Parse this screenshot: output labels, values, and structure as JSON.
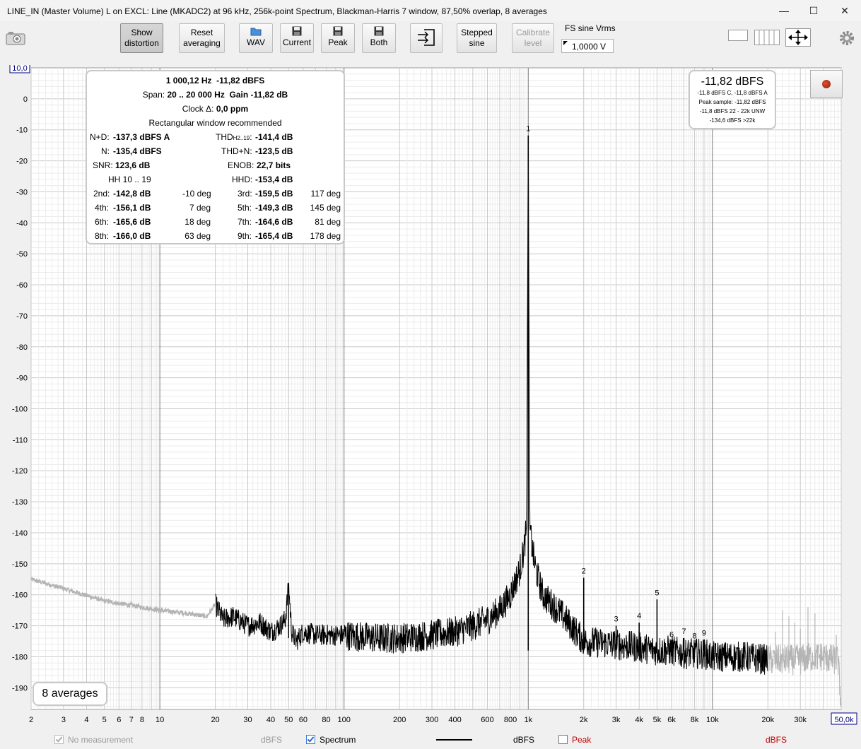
{
  "window": {
    "title": "LINE_IN (Master Volume) L on EXCL: Line (MKADC2) at 96 kHz, 256k-point Spectrum, Blackman-Harris 7 window, 87,50% overlap, 8 averages",
    "minimize": "—",
    "maximize": "☐",
    "close": "✕"
  },
  "toolbar": {
    "show_distortion": [
      "Show",
      "distortion"
    ],
    "reset_averaging": [
      "Reset",
      "averaging"
    ],
    "wav": "WAV",
    "current": "Current",
    "peak": "Peak",
    "both": "Both",
    "stepped_sine": [
      "Stepped",
      "sine"
    ],
    "calibrate_level": [
      "Calibrate",
      "level"
    ],
    "fs_label": "FS sine Vrms",
    "fs_value": "1,0000 V"
  },
  "info": {
    "freq": "1 000,12 Hz",
    "level": "-11,82 dBFS",
    "span_label": "Span:",
    "span_value": "20 .. 20 000 Hz",
    "gain_label": "Gain",
    "gain_value": "-11,82 dB",
    "clock_label": "Clock Δ:",
    "clock_value": "0,0 ppm",
    "window_note": "Rectangular window recommended",
    "nd_label": "N+D:",
    "nd_value": "-137,3 dBFS A",
    "thd_label": "THD",
    "thd_sub": "H2..19",
    "thd_colon": ":",
    "thd_value": "-141,4 dB",
    "n_label": "N:",
    "n_value": "-135,4 dBFS",
    "thdn_label": "THD+N:",
    "thdn_value": "-123,5 dB",
    "snr_label": "SNR:",
    "snr_value": "123,6 dB",
    "enob_label": "ENOB:",
    "enob_value": "22,7 bits",
    "hh_label": "HH 10 .. 19",
    "hhd_label": "HHD:",
    "hhd_value": "-153,4 dB",
    "harmonics": [
      {
        "label": "2nd:",
        "value": "-142,8 dB",
        "phase": "-10 deg"
      },
      {
        "label": "3rd:",
        "value": "-159,5 dB",
        "phase": "117 deg"
      },
      {
        "label": "4th:",
        "value": "-156,1 dB",
        "phase": "7 deg"
      },
      {
        "label": "5th:",
        "value": "-149,3 dB",
        "phase": "145 deg"
      },
      {
        "label": "6th:",
        "value": "-165,6 dB",
        "phase": "18 deg"
      },
      {
        "label": "7th:",
        "value": "-164,6 dB",
        "phase": "81 deg"
      },
      {
        "label": "8th:",
        "value": "-166,0 dB",
        "phase": "63 deg"
      },
      {
        "label": "9th:",
        "value": "-165,4 dB",
        "phase": "178 deg"
      }
    ]
  },
  "readout": {
    "level": "-11,82 dBFS",
    "line1": "-11,8 dBFS C, -11,8 dBFS A",
    "line2": "Peak sample: -11,82 dBFS",
    "line3": "-11,8 dBFS 22 - 22k UNW",
    "line4": "-134,6 dBFS >22k"
  },
  "averages_badge": "8 averages",
  "legend": {
    "no_measurement": "No measurement",
    "no_measurement_unit": "dBFS",
    "spectrum": "Spectrum",
    "spectrum_unit": "dBFS",
    "peak": "Peak",
    "peak_unit": "dBFS"
  },
  "colors": {
    "spectrum": "#000000",
    "out_of_band": "#b4b4b4",
    "peak": "#c00000",
    "axis_box": "#000080"
  },
  "chart_data": {
    "type": "line",
    "ylabel": "dBFS",
    "ylim": [
      -197,
      10
    ],
    "ytop_label": "10,0",
    "yticks": [
      0,
      -10,
      -20,
      -30,
      -40,
      -50,
      -60,
      -70,
      -80,
      -90,
      -100,
      -110,
      -120,
      -130,
      -140,
      -150,
      -160,
      -170,
      -180,
      -190
    ],
    "xscale": "log",
    "xlim": [
      2,
      50000
    ],
    "xmax_label": "50,0k",
    "xticks": [
      {
        "v": 2,
        "l": "2"
      },
      {
        "v": 3,
        "l": "3"
      },
      {
        "v": 4,
        "l": "4"
      },
      {
        "v": 5,
        "l": "5"
      },
      {
        "v": 6,
        "l": "6"
      },
      {
        "v": 7,
        "l": "7"
      },
      {
        "v": 8,
        "l": "8"
      },
      {
        "v": 10,
        "l": "10"
      },
      {
        "v": 20,
        "l": "20"
      },
      {
        "v": 30,
        "l": "30"
      },
      {
        "v": 40,
        "l": "40"
      },
      {
        "v": 50,
        "l": "50"
      },
      {
        "v": 60,
        "l": "60"
      },
      {
        "v": 80,
        "l": "80"
      },
      {
        "v": 100,
        "l": "100"
      },
      {
        "v": 200,
        "l": "200"
      },
      {
        "v": 300,
        "l": "300"
      },
      {
        "v": 400,
        "l": "400"
      },
      {
        "v": 600,
        "l": "600"
      },
      {
        "v": 800,
        "l": "800"
      },
      {
        "v": 1000,
        "l": "1k"
      },
      {
        "v": 2000,
        "l": "2k"
      },
      {
        "v": 3000,
        "l": "3k"
      },
      {
        "v": 4000,
        "l": "4k"
      },
      {
        "v": 5000,
        "l": "5k"
      },
      {
        "v": 6000,
        "l": "6k"
      },
      {
        "v": 8000,
        "l": "8k"
      },
      {
        "v": 10000,
        "l": "10k"
      },
      {
        "v": 20000,
        "l": "20k"
      },
      {
        "v": 30000,
        "l": "30k"
      }
    ],
    "series": [
      {
        "name": "Spectrum",
        "x": [
          2,
          3,
          5,
          8,
          10,
          14,
          18,
          20,
          22,
          25,
          30,
          35,
          40,
          45,
          48,
          50,
          52,
          55,
          60,
          70,
          100,
          150,
          200,
          300,
          400,
          500,
          600,
          700,
          800,
          900,
          950,
          980,
          1000,
          1020,
          1050,
          1100,
          1200,
          1500,
          2000,
          3000,
          4000,
          5000,
          6000,
          7000,
          8000,
          9000,
          10000,
          15000,
          20000,
          25000,
          30000,
          35000,
          40000,
          45000,
          48000,
          50000
        ],
        "y": [
          -155,
          -158,
          -162,
          -164,
          -165,
          -166,
          -167,
          -163,
          -168,
          -167,
          -170,
          -169,
          -172,
          -170,
          -168,
          -157,
          -172,
          -175,
          -172,
          -173,
          -173,
          -174,
          -174,
          -173,
          -172,
          -170,
          -168,
          -165,
          -160,
          -152,
          -145,
          -138,
          -11.82,
          -138,
          -145,
          -152,
          -160,
          -166,
          -175,
          -176,
          -177,
          -178,
          -178,
          -179,
          -179,
          -179,
          -180,
          -180,
          -181,
          -181,
          -181,
          -180,
          -180,
          -181,
          -181,
          -196
        ]
      }
    ],
    "harmonic_markers": [
      {
        "n": "1",
        "x": 1000,
        "y": -11.82
      },
      {
        "n": "2",
        "x": 2000,
        "y": -154.5
      },
      {
        "n": "3",
        "x": 3000,
        "y": -170
      },
      {
        "n": "4",
        "x": 4000,
        "y": -169
      },
      {
        "n": "5",
        "x": 5000,
        "y": -161.5
      },
      {
        "n": "6",
        "x": 6000,
        "y": -175
      },
      {
        "n": "7",
        "x": 7000,
        "y": -174
      },
      {
        "n": "8",
        "x": 8000,
        "y": -175.5
      },
      {
        "n": "9",
        "x": 9000,
        "y": -174.5
      }
    ]
  }
}
